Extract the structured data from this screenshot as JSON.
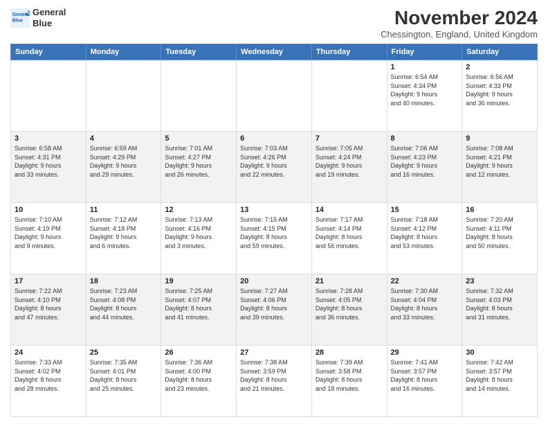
{
  "header": {
    "logo_line1": "General",
    "logo_line2": "Blue",
    "title": "November 2024",
    "subtitle": "Chessington, England, United Kingdom"
  },
  "days_of_week": [
    "Sunday",
    "Monday",
    "Tuesday",
    "Wednesday",
    "Thursday",
    "Friday",
    "Saturday"
  ],
  "weeks": [
    [
      {
        "day": "",
        "info": ""
      },
      {
        "day": "",
        "info": ""
      },
      {
        "day": "",
        "info": ""
      },
      {
        "day": "",
        "info": ""
      },
      {
        "day": "",
        "info": ""
      },
      {
        "day": "1",
        "info": "Sunrise: 6:54 AM\nSunset: 4:34 PM\nDaylight: 9 hours\nand 40 minutes."
      },
      {
        "day": "2",
        "info": "Sunrise: 6:56 AM\nSunset: 4:33 PM\nDaylight: 9 hours\nand 36 minutes."
      }
    ],
    [
      {
        "day": "3",
        "info": "Sunrise: 6:58 AM\nSunset: 4:31 PM\nDaylight: 9 hours\nand 33 minutes."
      },
      {
        "day": "4",
        "info": "Sunrise: 6:59 AM\nSunset: 4:29 PM\nDaylight: 9 hours\nand 29 minutes."
      },
      {
        "day": "5",
        "info": "Sunrise: 7:01 AM\nSunset: 4:27 PM\nDaylight: 9 hours\nand 26 minutes."
      },
      {
        "day": "6",
        "info": "Sunrise: 7:03 AM\nSunset: 4:26 PM\nDaylight: 9 hours\nand 22 minutes."
      },
      {
        "day": "7",
        "info": "Sunrise: 7:05 AM\nSunset: 4:24 PM\nDaylight: 9 hours\nand 19 minutes."
      },
      {
        "day": "8",
        "info": "Sunrise: 7:06 AM\nSunset: 4:23 PM\nDaylight: 9 hours\nand 16 minutes."
      },
      {
        "day": "9",
        "info": "Sunrise: 7:08 AM\nSunset: 4:21 PM\nDaylight: 9 hours\nand 12 minutes."
      }
    ],
    [
      {
        "day": "10",
        "info": "Sunrise: 7:10 AM\nSunset: 4:19 PM\nDaylight: 9 hours\nand 9 minutes."
      },
      {
        "day": "11",
        "info": "Sunrise: 7:12 AM\nSunset: 4:18 PM\nDaylight: 9 hours\nand 6 minutes."
      },
      {
        "day": "12",
        "info": "Sunrise: 7:13 AM\nSunset: 4:16 PM\nDaylight: 9 hours\nand 3 minutes."
      },
      {
        "day": "13",
        "info": "Sunrise: 7:15 AM\nSunset: 4:15 PM\nDaylight: 8 hours\nand 59 minutes."
      },
      {
        "day": "14",
        "info": "Sunrise: 7:17 AM\nSunset: 4:14 PM\nDaylight: 8 hours\nand 56 minutes."
      },
      {
        "day": "15",
        "info": "Sunrise: 7:18 AM\nSunset: 4:12 PM\nDaylight: 8 hours\nand 53 minutes."
      },
      {
        "day": "16",
        "info": "Sunrise: 7:20 AM\nSunset: 4:11 PM\nDaylight: 8 hours\nand 50 minutes."
      }
    ],
    [
      {
        "day": "17",
        "info": "Sunrise: 7:22 AM\nSunset: 4:10 PM\nDaylight: 8 hours\nand 47 minutes."
      },
      {
        "day": "18",
        "info": "Sunrise: 7:23 AM\nSunset: 4:08 PM\nDaylight: 8 hours\nand 44 minutes."
      },
      {
        "day": "19",
        "info": "Sunrise: 7:25 AM\nSunset: 4:07 PM\nDaylight: 8 hours\nand 41 minutes."
      },
      {
        "day": "20",
        "info": "Sunrise: 7:27 AM\nSunset: 4:06 PM\nDaylight: 8 hours\nand 39 minutes."
      },
      {
        "day": "21",
        "info": "Sunrise: 7:28 AM\nSunset: 4:05 PM\nDaylight: 8 hours\nand 36 minutes."
      },
      {
        "day": "22",
        "info": "Sunrise: 7:30 AM\nSunset: 4:04 PM\nDaylight: 8 hours\nand 33 minutes."
      },
      {
        "day": "23",
        "info": "Sunrise: 7:32 AM\nSunset: 4:03 PM\nDaylight: 8 hours\nand 31 minutes."
      }
    ],
    [
      {
        "day": "24",
        "info": "Sunrise: 7:33 AM\nSunset: 4:02 PM\nDaylight: 8 hours\nand 28 minutes."
      },
      {
        "day": "25",
        "info": "Sunrise: 7:35 AM\nSunset: 4:01 PM\nDaylight: 8 hours\nand 25 minutes."
      },
      {
        "day": "26",
        "info": "Sunrise: 7:36 AM\nSunset: 4:00 PM\nDaylight: 8 hours\nand 23 minutes."
      },
      {
        "day": "27",
        "info": "Sunrise: 7:38 AM\nSunset: 3:59 PM\nDaylight: 8 hours\nand 21 minutes."
      },
      {
        "day": "28",
        "info": "Sunrise: 7:39 AM\nSunset: 3:58 PM\nDaylight: 8 hours\nand 18 minutes."
      },
      {
        "day": "29",
        "info": "Sunrise: 7:41 AM\nSunset: 3:57 PM\nDaylight: 8 hours\nand 16 minutes."
      },
      {
        "day": "30",
        "info": "Sunrise: 7:42 AM\nSunset: 3:57 PM\nDaylight: 8 hours\nand 14 minutes."
      }
    ]
  ]
}
